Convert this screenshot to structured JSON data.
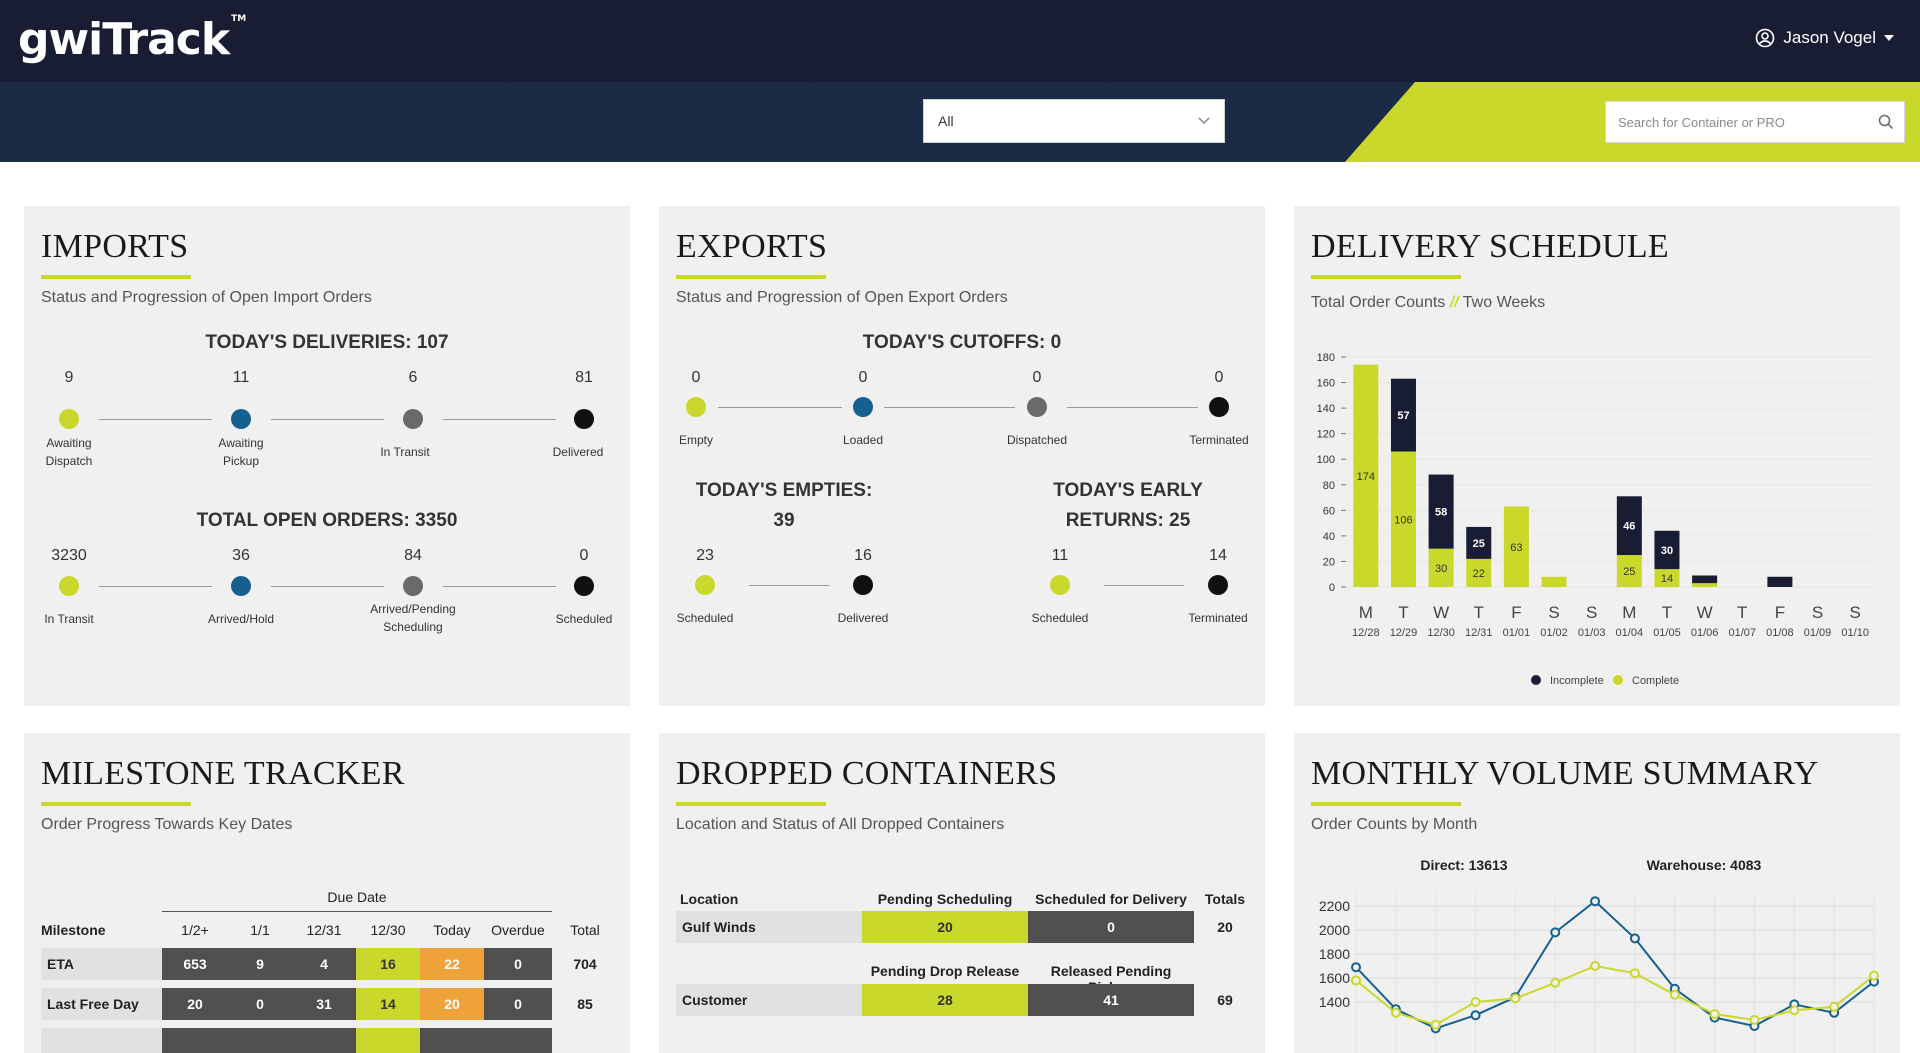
{
  "app": {
    "logo": "gwiTrack",
    "logo_tm": "TM"
  },
  "user": {
    "name": "Jason Vogel"
  },
  "filter": {
    "selected": "All"
  },
  "search": {
    "placeholder": "Search for Container or PRO"
  },
  "colors": {
    "lime": "#c9d82b",
    "navy": "#181d33",
    "blue": "#15608e",
    "orange": "#f0a23a",
    "dark": "#505050"
  },
  "imports": {
    "title": "IMPORTS",
    "subtitle": "Status and Progression of Open Import Orders",
    "deliveries_heading": "TODAY'S DELIVERIES: 107",
    "deliveries": [
      {
        "value": "9",
        "label": "Awaiting Dispatch",
        "color": "lime"
      },
      {
        "value": "11",
        "label": "Awaiting Pickup",
        "color": "blue"
      },
      {
        "value": "6",
        "label": "In Transit",
        "color": "gray"
      },
      {
        "value": "81",
        "label": "Delivered",
        "color": "black"
      }
    ],
    "open_heading": "TOTAL OPEN ORDERS: 3350",
    "open": [
      {
        "value": "3230",
        "label": "In Transit",
        "color": "lime"
      },
      {
        "value": "36",
        "label": "Arrived/Hold",
        "color": "blue"
      },
      {
        "value": "84",
        "label": "Arrived/Pending Scheduling",
        "color": "gray"
      },
      {
        "value": "0",
        "label": "Scheduled",
        "color": "black"
      }
    ]
  },
  "exports": {
    "title": "EXPORTS",
    "subtitle": "Status and Progression of Open Export Orders",
    "cutoffs_heading": "TODAY'S CUTOFFS: 0",
    "cutoffs": [
      {
        "value": "0",
        "label": "Empty",
        "color": "lime"
      },
      {
        "value": "0",
        "label": "Loaded",
        "color": "blue"
      },
      {
        "value": "0",
        "label": "Dispatched",
        "color": "gray"
      },
      {
        "value": "0",
        "label": "Terminated",
        "color": "black"
      }
    ],
    "empties_heading_1": "TODAY'S EMPTIES:",
    "empties_heading_2": "39",
    "empties": [
      {
        "value": "23",
        "label": "Scheduled",
        "color": "lime"
      },
      {
        "value": "16",
        "label": "Delivered",
        "color": "black"
      }
    ],
    "early_heading_1": "TODAY'S EARLY",
    "early_heading_2": "RETURNS: 25",
    "early": [
      {
        "value": "11",
        "label": "Scheduled",
        "color": "lime"
      },
      {
        "value": "14",
        "label": "Terminated",
        "color": "black"
      }
    ]
  },
  "delivery": {
    "title": "DELIVERY SCHEDULE",
    "subtitle_a": "Total Order Counts",
    "subtitle_sep": "//",
    "subtitle_b": "Two Weeks"
  },
  "chart_data": [
    {
      "type": "bar",
      "stacked": true,
      "categories": [
        "M 12/28",
        "T 12/29",
        "W 12/30",
        "T 12/31",
        "F 01/01",
        "S 01/02",
        "S 01/03",
        "M 01/04",
        "T 01/05",
        "W 01/06",
        "T 01/07",
        "F 01/08",
        "S 01/09",
        "S 01/10"
      ],
      "day_letters": [
        "M",
        "T",
        "W",
        "T",
        "F",
        "S",
        "S",
        "M",
        "T",
        "W",
        "T",
        "F",
        "S",
        "S"
      ],
      "dates": [
        "12/28",
        "12/29",
        "12/30",
        "12/31",
        "01/01",
        "01/02",
        "01/03",
        "01/04",
        "01/05",
        "01/06",
        "01/07",
        "01/08",
        "01/09",
        "01/10"
      ],
      "series": [
        {
          "name": "Complete",
          "color": "#c9d82b",
          "values": [
            174,
            106,
            30,
            22,
            63,
            8,
            0,
            25,
            14,
            3,
            0,
            0,
            0,
            0
          ]
        },
        {
          "name": "Incomplete",
          "color": "#181d33",
          "values": [
            0,
            57,
            58,
            25,
            0,
            0,
            0,
            46,
            30,
            6,
            0,
            8,
            0,
            0
          ]
        }
      ],
      "ylim": [
        0,
        180
      ],
      "yticks": [
        0,
        20,
        40,
        60,
        80,
        100,
        120,
        140,
        160,
        180
      ],
      "legend": [
        "Incomplete",
        "Complete"
      ],
      "legend_position": "bottom",
      "grid": true
    },
    {
      "type": "line",
      "series": [
        {
          "name": "Direct",
          "color": "#15608e",
          "values": [
            1690,
            1340,
            1180,
            1290,
            1440,
            1980,
            2240,
            1930,
            1510,
            1270,
            1200,
            1380,
            1310,
            1570
          ]
        },
        {
          "name": "Warehouse",
          "color": "#c9d82b",
          "values": [
            1580,
            1310,
            1210,
            1400,
            1430,
            1560,
            1700,
            1640,
            1460,
            1300,
            1250,
            1330,
            1360,
            1620
          ]
        }
      ],
      "yticks": [
        1400,
        1600,
        1800,
        2000,
        2200
      ],
      "ylim": [
        1300,
        2300
      ],
      "grid": true
    }
  ],
  "milestone": {
    "title": "MILESTONE TRACKER",
    "subtitle": "Order Progress Towards Key Dates",
    "due_date_label": "Due Date",
    "headers": [
      "Milestone",
      "1/2+",
      "1/1",
      "12/31",
      "12/30",
      "Today",
      "Overdue",
      "Total"
    ],
    "rows": [
      {
        "name": "ETA",
        "cells": [
          "653",
          "9",
          "4",
          "16",
          "22",
          "0"
        ],
        "total": "704"
      },
      {
        "name": "Last Free Day",
        "cells": [
          "20",
          "0",
          "31",
          "14",
          "20",
          "0"
        ],
        "total": "85"
      }
    ]
  },
  "dropped": {
    "title": "DROPPED CONTAINERS",
    "subtitle": "Location and Status of All Dropped Containers",
    "location_header": "Location",
    "totals_header": "Totals",
    "rows": [
      {
        "col1_header": "Pending Scheduling",
        "col2_header": "Scheduled for Delivery",
        "location": "Gulf Winds",
        "col1": "20",
        "col2": "0",
        "total": "20"
      },
      {
        "col1_header": "Pending Drop Release",
        "col2_header": "Released Pending Pickup",
        "location": "Customer",
        "col1": "28",
        "col2": "41",
        "total": "69"
      }
    ]
  },
  "monthly": {
    "title": "MONTHLY VOLUME SUMMARY",
    "subtitle": "Order Counts by Month",
    "direct_label": "Direct: 13613",
    "warehouse_label": "Warehouse: 4083"
  },
  "legend": {
    "incomplete": "Incomplete",
    "complete": "Complete"
  }
}
